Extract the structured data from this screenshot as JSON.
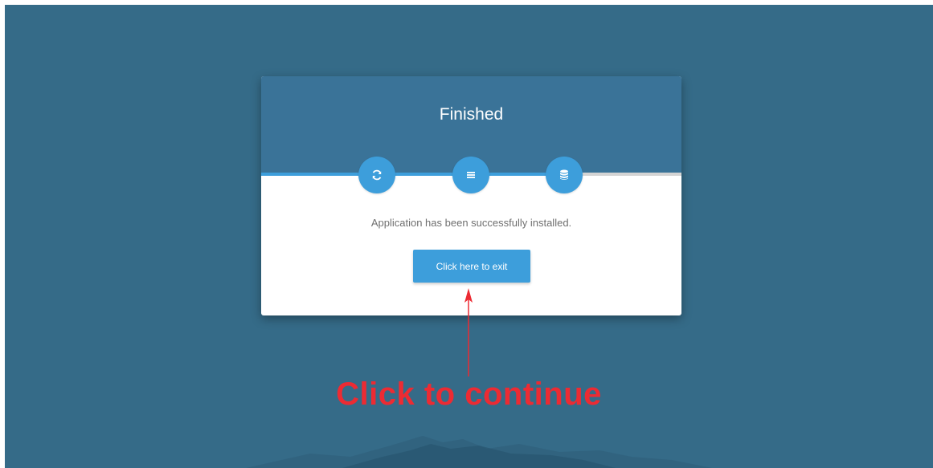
{
  "card": {
    "title": "Finished",
    "message": "Application has been successfully installed.",
    "exit_button_label": "Click here to exit"
  },
  "steps": [
    {
      "icon": "refresh-icon",
      "completed": true
    },
    {
      "icon": "list-icon",
      "completed": true
    },
    {
      "icon": "database-icon",
      "completed": true
    }
  ],
  "progress": {
    "fill_fraction": 0.74
  },
  "annotation": {
    "text": "Click to continue"
  },
  "colors": {
    "background": "#356b88",
    "header": "#3a7398",
    "accent": "#3d9edb",
    "annotation": "#ec2b33"
  }
}
